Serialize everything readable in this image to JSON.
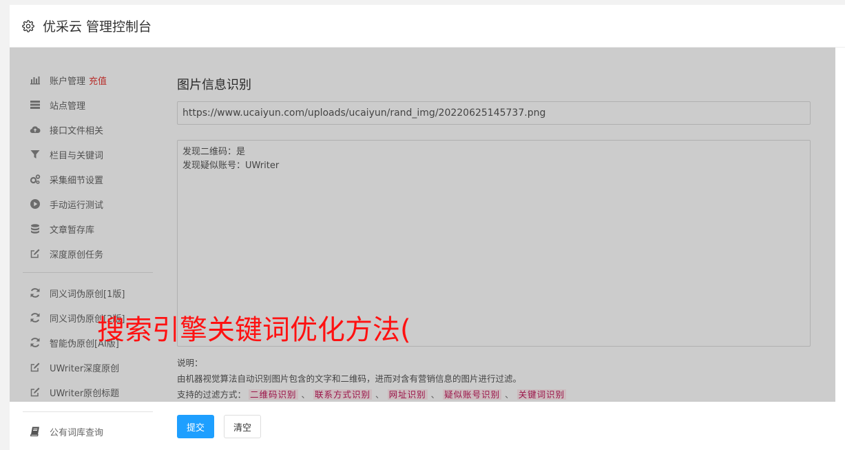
{
  "header": {
    "title": "优采云 管理控制台"
  },
  "sidebar": {
    "account": {
      "label": "账户管理",
      "recharge": "充值"
    },
    "items": [
      {
        "label": "站点管理",
        "icon": "server-icon"
      },
      {
        "label": "接口文件相关",
        "icon": "cloud-upload-icon"
      },
      {
        "label": "栏目与关键词",
        "icon": "filter-icon"
      },
      {
        "label": "采集细节设置",
        "icon": "gears-icon"
      },
      {
        "label": "手动运行测试",
        "icon": "play-circle-icon"
      },
      {
        "label": "文章暂存库",
        "icon": "database-icon"
      },
      {
        "label": "深度原创任务",
        "icon": "edit-icon"
      }
    ],
    "items2": [
      {
        "label": "同义词伪原创[1版]",
        "icon": "refresh-icon"
      },
      {
        "label": "同义词伪原创[2版]",
        "icon": "refresh-icon"
      },
      {
        "label": "智能伪原创[AI版]",
        "icon": "refresh-icon"
      },
      {
        "label": "UWriter深度原创",
        "icon": "edit-icon"
      },
      {
        "label": "UWriter原创标题",
        "icon": "edit-icon"
      }
    ],
    "items3": [
      {
        "label": "公有词库查询",
        "icon": "book-icon"
      }
    ]
  },
  "main": {
    "title": "图片信息识别",
    "url_value": "https://www.ucaiyun.com/uploads/ucaiyun/rand_img/20220625145737.png",
    "result_lines": [
      "发现二维码：是",
      "发现疑似账号：UWriter"
    ],
    "notes_label": "说明：",
    "notes_text": "由机器视觉算法自动识别图片包含的文字和二维码，进而对含有营销信息的图片进行过滤。",
    "filters_label": "支持的过滤方式：",
    "filters": [
      "二维码识别",
      "联系方式识别",
      "网址识别",
      "疑似账号识别",
      "关键词识别"
    ],
    "filter_sep": "、",
    "submit_label": "提交",
    "clear_label": "清空"
  },
  "watermark": "搜索引擎关键词优化方法(",
  "colors": {
    "accent": "#1e9fff",
    "recharge": "#e53935",
    "watermark": "#ff1111"
  }
}
